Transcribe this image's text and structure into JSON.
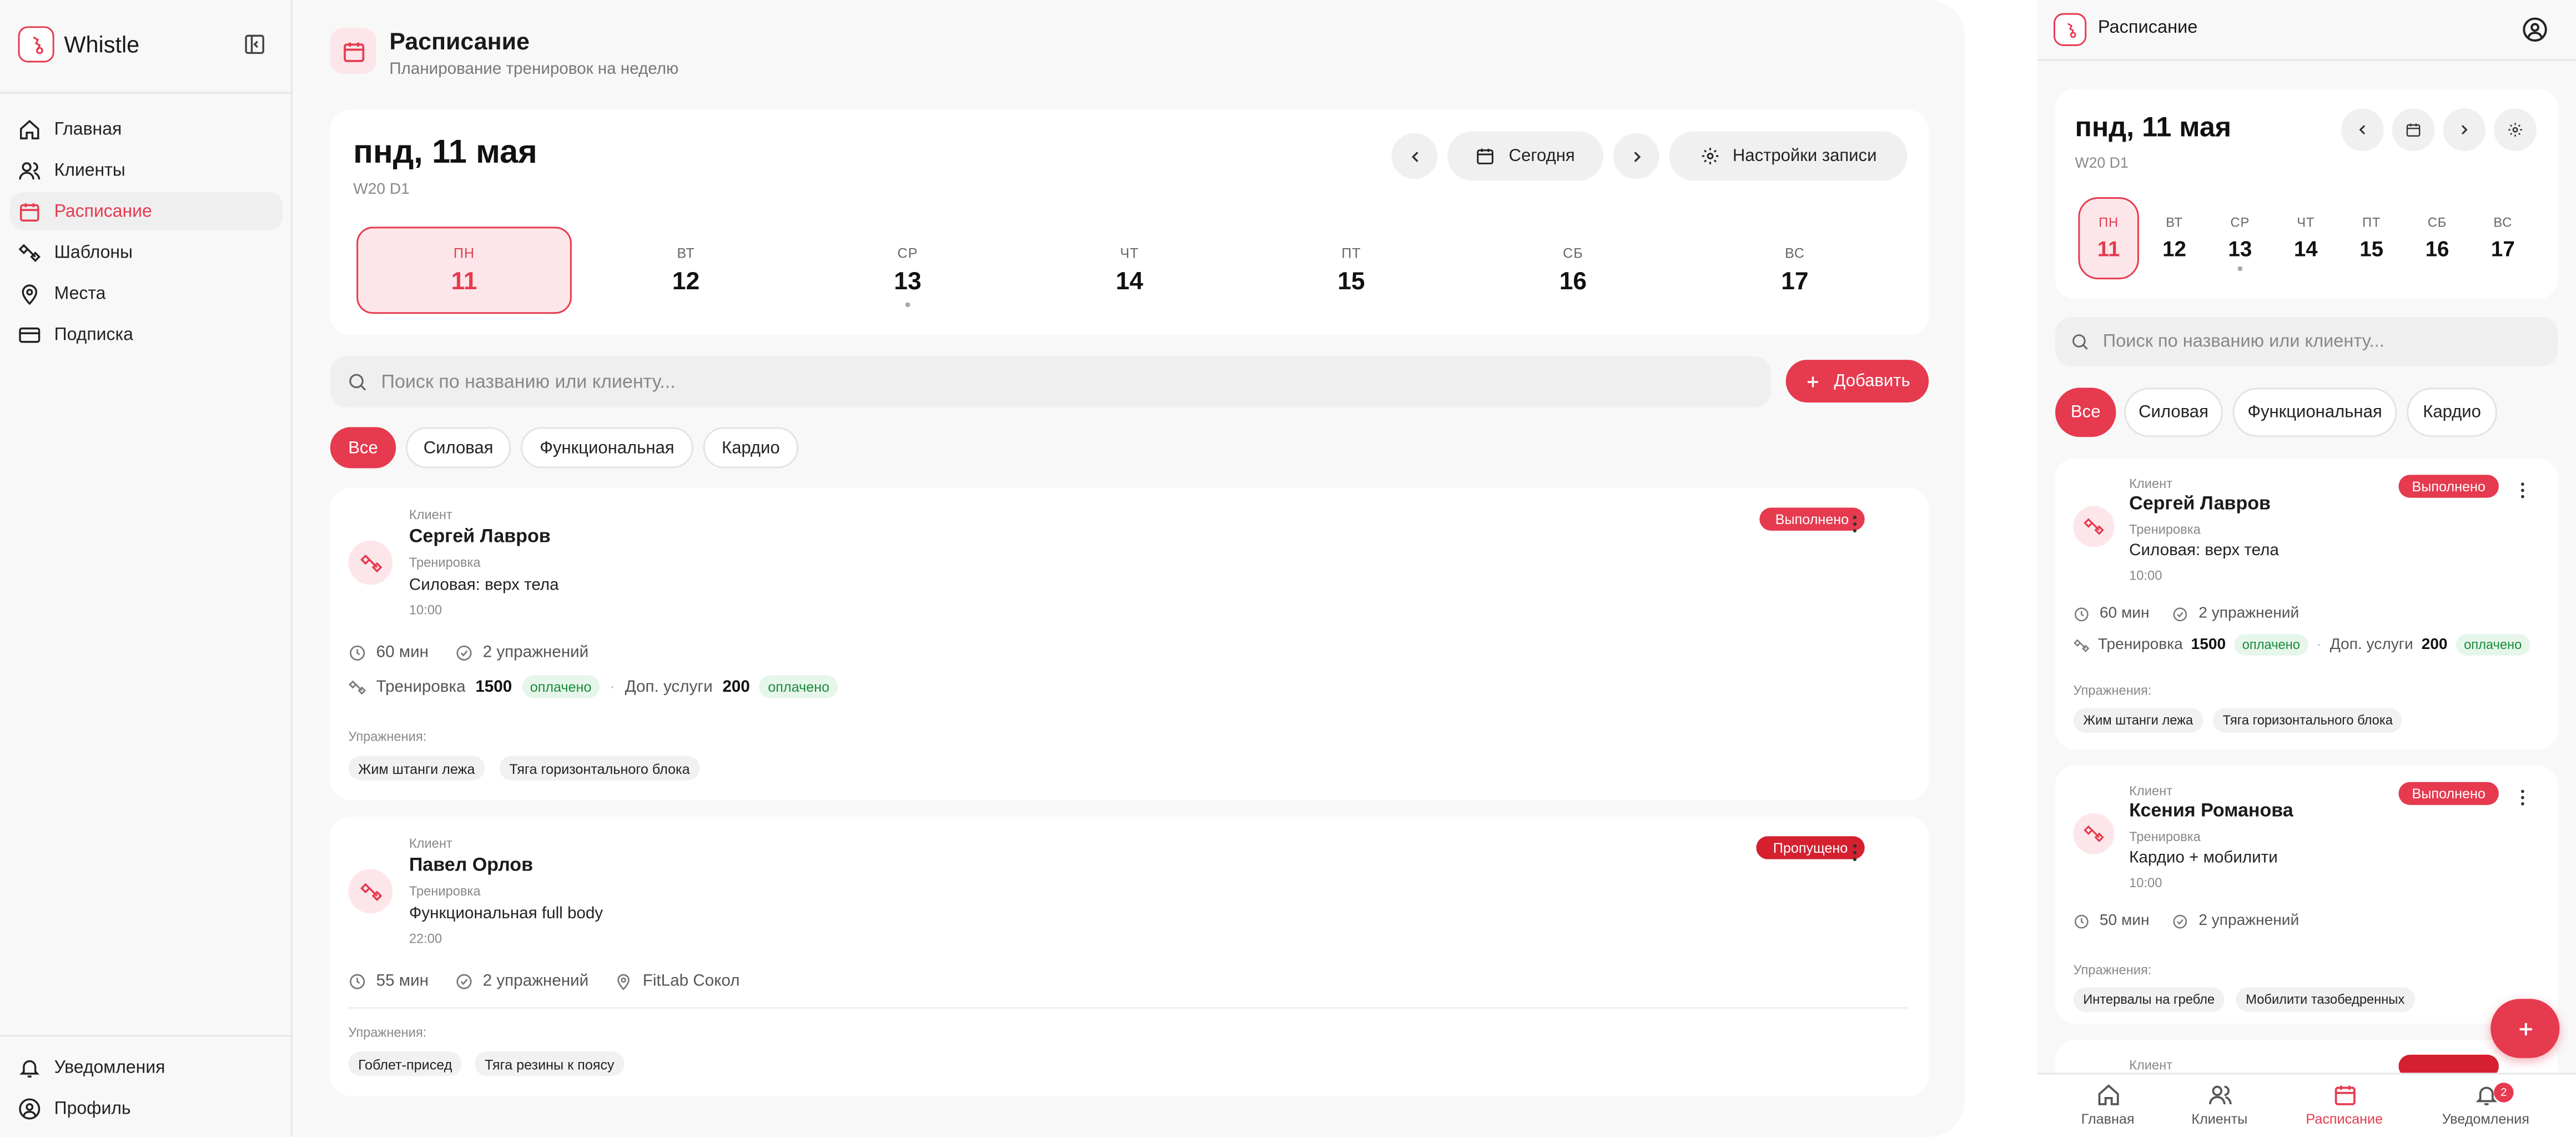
{
  "app": {
    "name": "Whistle"
  },
  "sidebar": {
    "items": [
      {
        "label": "Главная"
      },
      {
        "label": "Клиенты"
      },
      {
        "label": "Расписание"
      },
      {
        "label": "Шаблоны"
      },
      {
        "label": "Места"
      },
      {
        "label": "Подписка"
      }
    ],
    "bottom": [
      {
        "label": "Уведомления"
      },
      {
        "label": "Профиль"
      }
    ]
  },
  "header": {
    "title": "Расписание",
    "subtitle": "Планирование тренировок на неделю"
  },
  "schedule": {
    "date_title": "пнд, 11 мая",
    "week_code": "W20 D1",
    "today_label": "Сегодня",
    "settings_label": "Настройки записи",
    "days": [
      {
        "label": "ПН",
        "num": "11"
      },
      {
        "label": "ВТ",
        "num": "12"
      },
      {
        "label": "СР",
        "num": "13"
      },
      {
        "label": "ЧТ",
        "num": "14"
      },
      {
        "label": "ПТ",
        "num": "15"
      },
      {
        "label": "СБ",
        "num": "16"
      },
      {
        "label": "ВС",
        "num": "17"
      }
    ]
  },
  "search": {
    "placeholder": "Поиск по названию или клиенту..."
  },
  "add_label": "Добавить",
  "filters": [
    {
      "label": "Все"
    },
    {
      "label": "Силовая"
    },
    {
      "label": "Функциональная"
    },
    {
      "label": "Кардио"
    }
  ],
  "labels": {
    "client": "Клиент",
    "training": "Тренировка",
    "exercises": "Упражнения:",
    "extra": "Доп. услуги",
    "paid": "оплачено"
  },
  "sessions": [
    {
      "client": "Сергей Лавров",
      "workout": "Силовая: верх тела",
      "time": "10:00",
      "status": "Выполнено",
      "duration": "60 мин",
      "exercise_count": "2 упражнений",
      "training_price": "1500",
      "extra_price": "200",
      "exercises": [
        "Жим штанги лежа",
        "Тяга горизонтального блока"
      ]
    },
    {
      "client": "Павел Орлов",
      "workout": "Функциональная full body",
      "time": "22:00",
      "status": "Пропущено",
      "duration": "55 мин",
      "exercise_count": "2 упражнений",
      "location": "FitLab Сокол",
      "exercises": [
        "Гоблет-присед",
        "Тяга резины к поясу"
      ]
    }
  ],
  "mobile": {
    "title": "Расписание",
    "session2": {
      "client": "Ксения Романова",
      "workout": "Кардио + мобилити",
      "time": "10:00",
      "status": "Выполнено",
      "duration": "50 мин",
      "exercise_count": "2 упражнений",
      "exercises": [
        "Интервалы на гребле",
        "Мобилити тазобедренных"
      ]
    },
    "peek_label": "Клиент",
    "tabs": [
      {
        "label": "Главная"
      },
      {
        "label": "Клиенты"
      },
      {
        "label": "Расписание"
      },
      {
        "label": "Уведомления"
      }
    ],
    "notif_count": "2"
  },
  "colors": {
    "accent": "#e63a4f",
    "done": "#e63a4f",
    "missed": "#d4202f",
    "paid_bg": "#e6f6ea"
  },
  "icons": {
    "logo": "whistle-logo",
    "collapse": "sidebar-collapse-icon",
    "nav": [
      "home-icon",
      "users-icon",
      "calendar-icon",
      "templates-icon",
      "map-pin-icon",
      "card-icon"
    ],
    "bottom": [
      "bell-icon",
      "user-circle-icon"
    ]
  }
}
